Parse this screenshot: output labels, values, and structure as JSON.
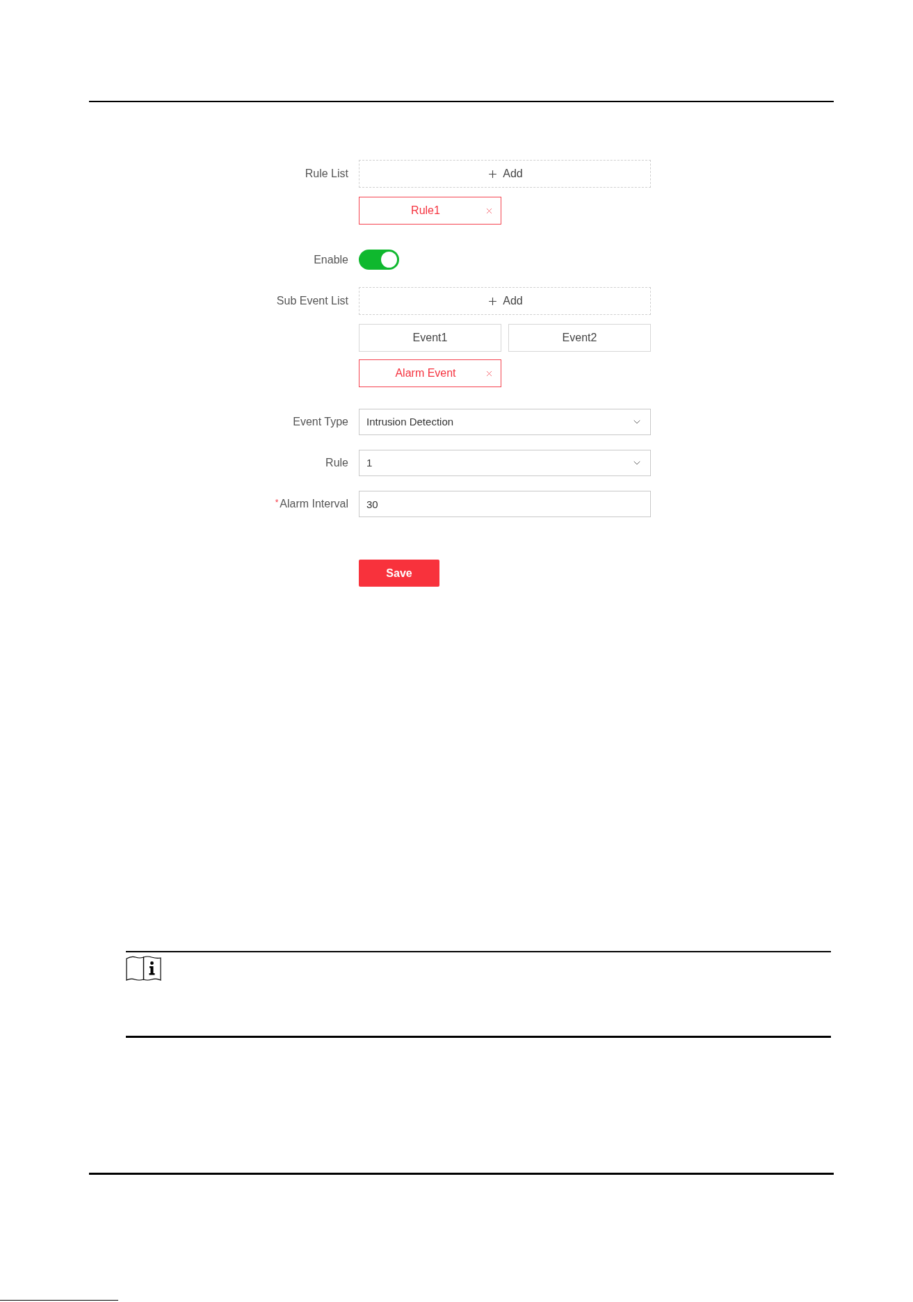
{
  "form": {
    "rule_list": {
      "label": "Rule List",
      "add_label": "Add",
      "rules": [
        {
          "label": "Rule1",
          "selected": true
        }
      ]
    },
    "enable": {
      "label": "Enable",
      "on": true
    },
    "sub_event_list": {
      "label": "Sub Event List",
      "add_label": "Add",
      "events": [
        {
          "label": "Event1",
          "selected": false
        },
        {
          "label": "Event2",
          "selected": false
        },
        {
          "label": "Alarm Event",
          "selected": true
        }
      ]
    },
    "fields": [
      {
        "kind": "select",
        "label": "Event Type",
        "value": "Intrusion Detection"
      },
      {
        "kind": "select",
        "label": "Rule",
        "value": "1"
      },
      {
        "kind": "input",
        "label": "Alarm Interval",
        "required_mark": "*",
        "value": "30"
      }
    ],
    "save_label": "Save"
  }
}
